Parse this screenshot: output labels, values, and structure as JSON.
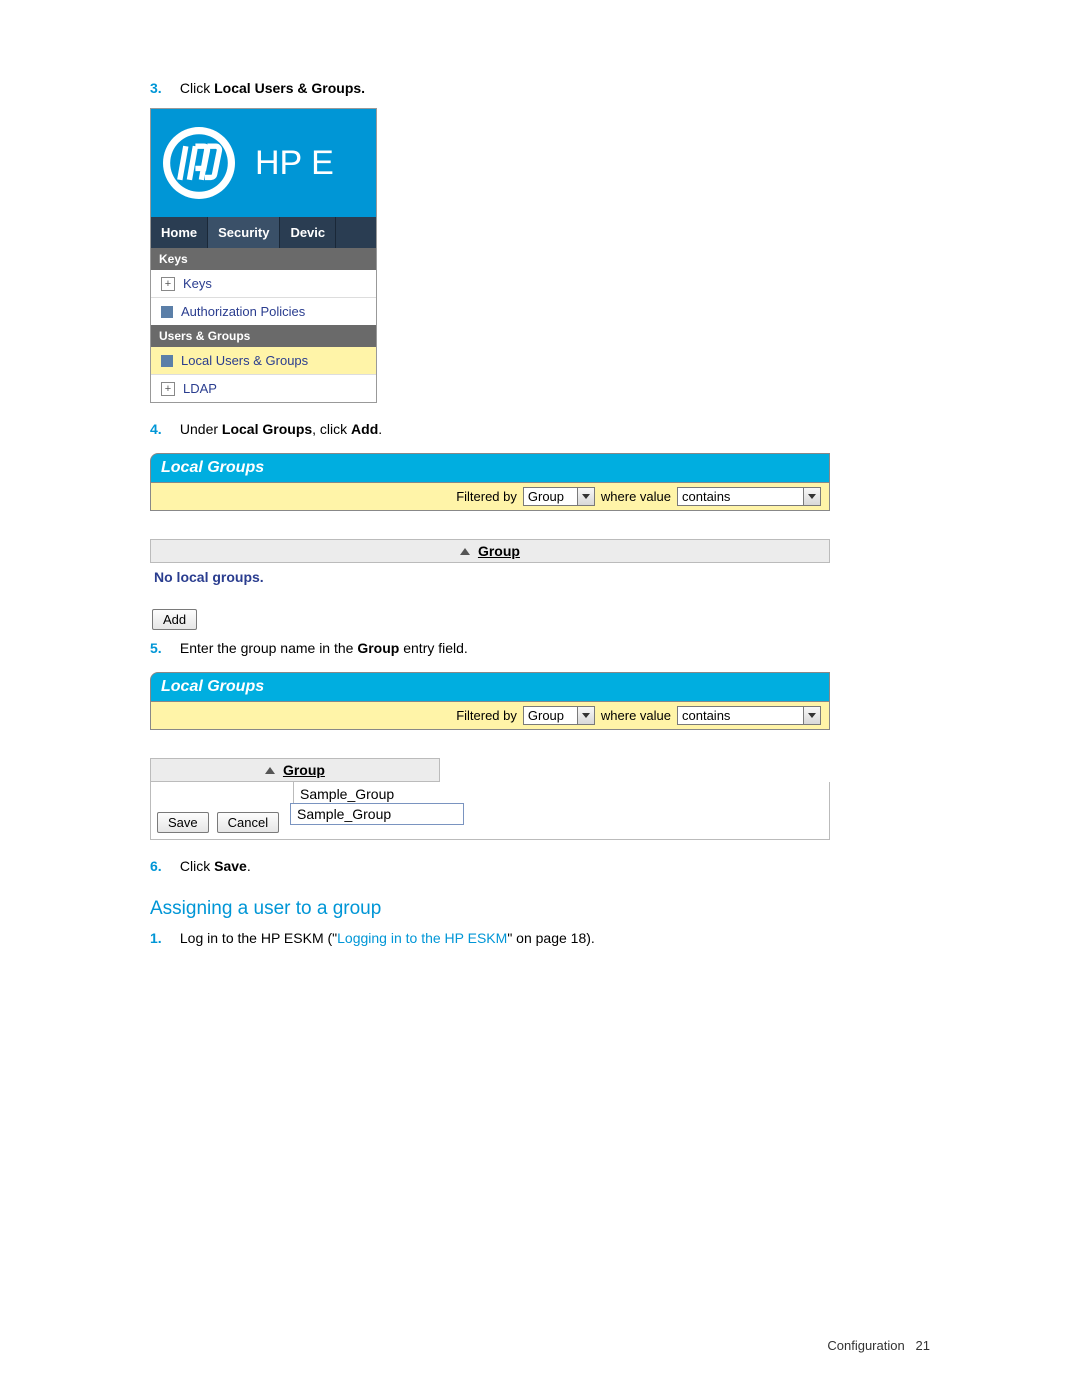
{
  "steps": {
    "s3": {
      "num": "3.",
      "pre": "Click ",
      "bold": "Local Users & Groups."
    },
    "s4": {
      "num": "4.",
      "pre": "Under ",
      "bold1": "Local Groups",
      "mid": ", click ",
      "bold2": "Add",
      "post": "."
    },
    "s5": {
      "num": "5.",
      "pre": "Enter the group name in the ",
      "bold": "Group",
      "post": " entry field."
    },
    "s6": {
      "num": "6.",
      "pre": "Click ",
      "bold": "Save",
      "post": "."
    }
  },
  "fig1": {
    "banner_text": "HP E",
    "tabs": {
      "home": "Home",
      "security": "Security",
      "device": "Devic"
    },
    "section1": "Keys",
    "items1": {
      "keys": "Keys",
      "auth": "Authorization Policies"
    },
    "section2": "Users & Groups",
    "items2": {
      "local": "Local Users & Groups",
      "ldap": "LDAP"
    }
  },
  "lg": {
    "title": "Local Groups",
    "filtered_by": "Filtered by",
    "sel1": "Group",
    "where": "where value",
    "sel2": "contains",
    "grouphead": "Group",
    "nolocal": "No local groups.",
    "add": "Add",
    "sample": "Sample_Group",
    "autocomplete": "Sample_Group",
    "save": "Save",
    "cancel": "Cancel"
  },
  "section_heading": "Assigning a user to a group",
  "sect2_step1": {
    "num": "1.",
    "pre": "Log in to the HP ESKM (\"",
    "link": "Logging in to the HP ESKM",
    "post": "\" on page 18)."
  },
  "footer": {
    "label": "Configuration",
    "page": "21"
  }
}
